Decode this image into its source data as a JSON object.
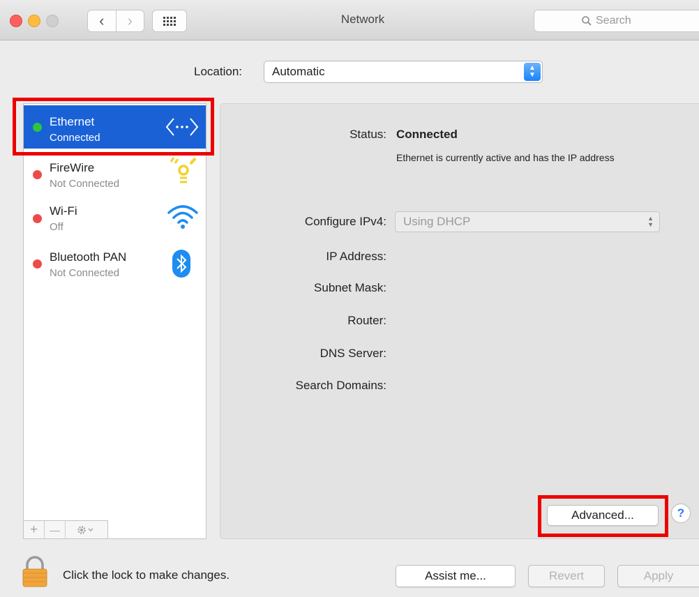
{
  "window": {
    "title": "Network",
    "search_placeholder": "Search"
  },
  "location": {
    "label": "Location:",
    "value": "Automatic"
  },
  "services": [
    {
      "name": "Ethernet",
      "status": "Connected",
      "dot_color": "#2fc43f",
      "icon": "ethernet-icon",
      "selected": true
    },
    {
      "name": "FireWire",
      "status": "Not Connected",
      "dot_color": "#ec4b49",
      "icon": "firewire-icon"
    },
    {
      "name": "Wi-Fi",
      "status": "Off",
      "dot_color": "#ec4b49",
      "icon": "wifi-icon"
    },
    {
      "name": "Bluetooth PAN",
      "status": "Not Connected",
      "dot_color": "#ec4b49",
      "icon": "bluetooth-icon"
    }
  ],
  "sidebar_tools": {
    "add": "+",
    "remove": "—"
  },
  "details": {
    "status_label": "Status:",
    "status_value": "Connected",
    "status_description": "Ethernet is currently active and has the IP address",
    "configure_label": "Configure IPv4:",
    "configure_value": "Using DHCP",
    "ip_label": "IP Address:",
    "subnet_label": "Subnet Mask:",
    "router_label": "Router:",
    "dns_label": "DNS Server:",
    "search_domains_label": "Search Domains:"
  },
  "buttons": {
    "advanced": "Advanced...",
    "help": "?",
    "assist": "Assist me...",
    "revert": "Revert",
    "apply": "Apply"
  },
  "footer": {
    "lock_text": "Click the lock to make changes."
  },
  "colors": {
    "selection": "#1a61d6",
    "highlight": "#ec0000",
    "connected": "#2fc43f",
    "not_connected": "#ec4b49"
  }
}
